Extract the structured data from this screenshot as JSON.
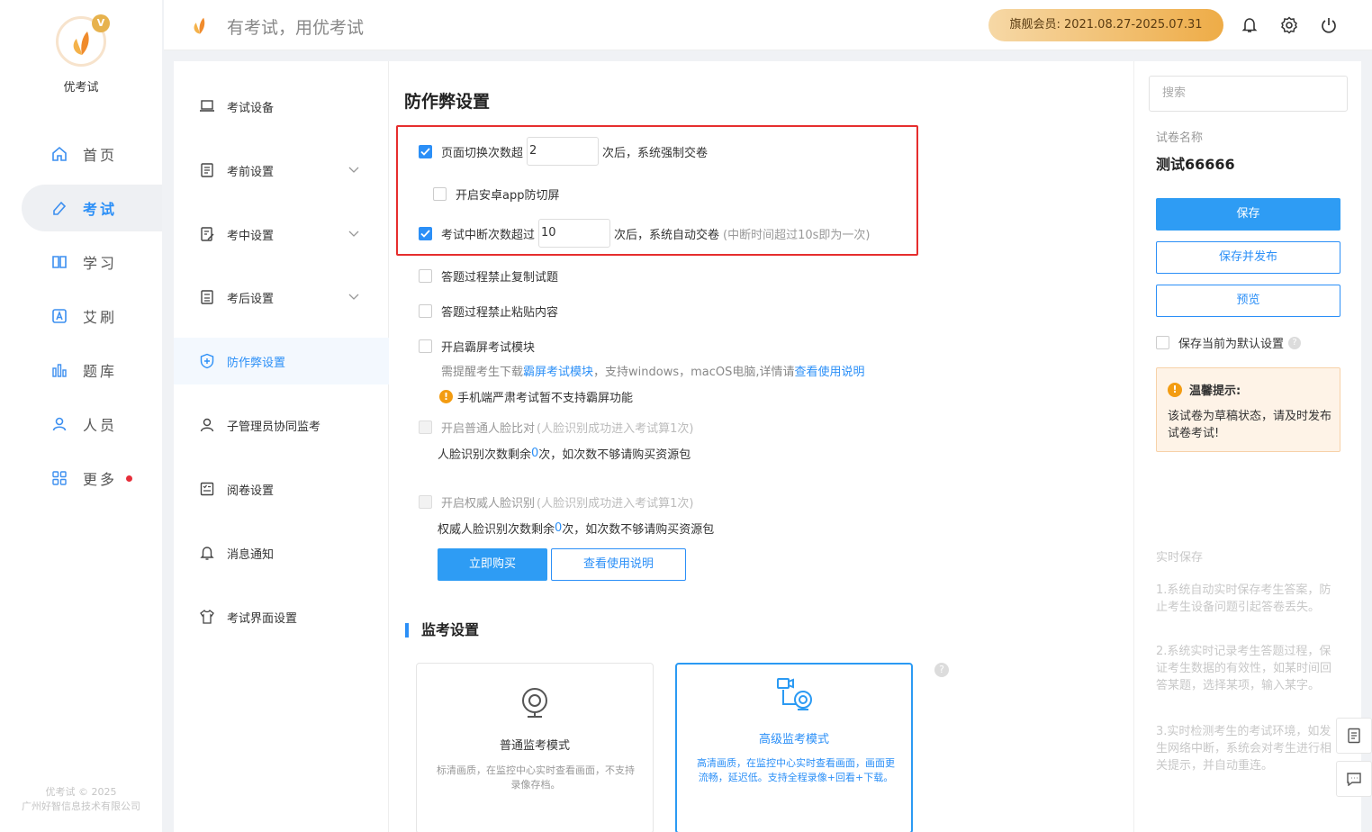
{
  "brand": {
    "name": "优考试",
    "slogan": "有考试，用优考试",
    "vip_badge": "V",
    "copyright_line1": "优考试 © 2025",
    "copyright_line2": "广州好智信息技术有限公司"
  },
  "nav": {
    "items": [
      {
        "label": "首页",
        "icon": "home-icon"
      },
      {
        "label": "考试",
        "icon": "exam-icon",
        "active": true
      },
      {
        "label": "学习",
        "icon": "book-icon"
      },
      {
        "label": "艾刷",
        "icon": "a-icon"
      },
      {
        "label": "题库",
        "icon": "bar-chart-icon"
      },
      {
        "label": "人员",
        "icon": "user-icon"
      },
      {
        "label": "更多",
        "icon": "grid-icon",
        "has_dot": true
      }
    ]
  },
  "topbar": {
    "vip_text": "旗舰会员: 2021.08.27-2025.07.31",
    "icons": [
      "bell-icon",
      "gear-icon",
      "power-icon"
    ]
  },
  "submenu": {
    "items": [
      {
        "label": "考试设备",
        "icon": "laptop-icon"
      },
      {
        "label": "考前设置",
        "icon": "doc-icon",
        "expandable": true
      },
      {
        "label": "考中设置",
        "icon": "edit-doc-icon",
        "expandable": true
      },
      {
        "label": "考后设置",
        "icon": "score-doc-icon",
        "expandable": true
      },
      {
        "label": "防作弊设置",
        "icon": "shield-icon",
        "active": true
      },
      {
        "label": "子管理员协同监考",
        "icon": "admin-user-icon"
      },
      {
        "label": "阅卷设置",
        "icon": "check-list-icon"
      },
      {
        "label": "消息通知",
        "icon": "bell-icon"
      },
      {
        "label": "考试界面设置",
        "icon": "shirt-icon"
      }
    ]
  },
  "anticheat": {
    "title": "防作弊设置",
    "switch_prefix": "页面切换次数超",
    "switch_value": "2",
    "switch_suffix": "次后，系统强制交卷",
    "android_label": "开启安卓app防切屏",
    "interrupt_prefix": "考试中断次数超过",
    "interrupt_value": "10",
    "interrupt_suffix": "次后，系统自动交卷",
    "interrupt_note": "(中断时间超过10s即为一次)",
    "no_copy": "答题过程禁止复制试题",
    "no_paste": "答题过程禁止粘贴内容",
    "lockscreen": "开启霸屏考试模块",
    "lockscreen_tip_a": "需提醒考生下载",
    "lockscreen_tip_link1": "霸屏考试模块",
    "lockscreen_tip_b": "，支持windows，macOS电脑,详情请",
    "lockscreen_tip_link2": "查看使用说明",
    "mobile_warning": "手机端严肃考试暂不支持霸屏功能",
    "face_label": "开启普通人脸比对",
    "face_note": "(人脸识别成功进入考试算1次)",
    "face_remain_a": "人脸识别次数剩余",
    "face_remain_num": "0",
    "face_remain_b": "次，如次数不够请购买资源包",
    "auth_face_label": "开启权威人脸识别",
    "auth_face_note": "(人脸识别成功进入考试算1次)",
    "auth_remain_a": "权威人脸识别次数剩余",
    "auth_remain_num": "0",
    "auth_remain_b": "次，如次数不够请购买资源包",
    "buy_button": "立即购买",
    "manual_button": "查看使用说明"
  },
  "monitor": {
    "title": "监考设置",
    "normal_name": "普通监考模式",
    "normal_desc": "标清画质，在监控中心实时查看画面，不支持录像存档。",
    "advanced_name": "高级监考模式",
    "advanced_desc": "高清画质，在监控中心实时查看画面，画面更流畅，延迟低。支持全程录像+回看+下载。",
    "help": "?"
  },
  "right": {
    "search_placeholder": "搜索",
    "paper_name_label": "试卷名称",
    "paper_name": "测试66666",
    "save": "保存",
    "save_publish": "保存并发布",
    "preview": "预览",
    "default_label": "保存当前为默认设置",
    "tip_title": "温馨提示:",
    "tip_text": "该试卷为草稿状态，请及时发布试卷考试!",
    "autosave_title": "实时保存",
    "autosave_1": "1.系统自动实时保存考生答案，防止考生设备问题引起答卷丢失。",
    "autosave_2": "2.系统实时记录考生答题过程，保证考生数据的有效性，如某时间回答某题，选择某项，输入某字。",
    "autosave_3": "3.实时检测考生的考试环境，如发生网络中断，系统会对考生进行相关提示，并自动重连。"
  },
  "colors": {
    "accent": "#2b8ff7",
    "highlight_border": "#e62e2e",
    "vip_gradient_end": "#eeac47"
  }
}
